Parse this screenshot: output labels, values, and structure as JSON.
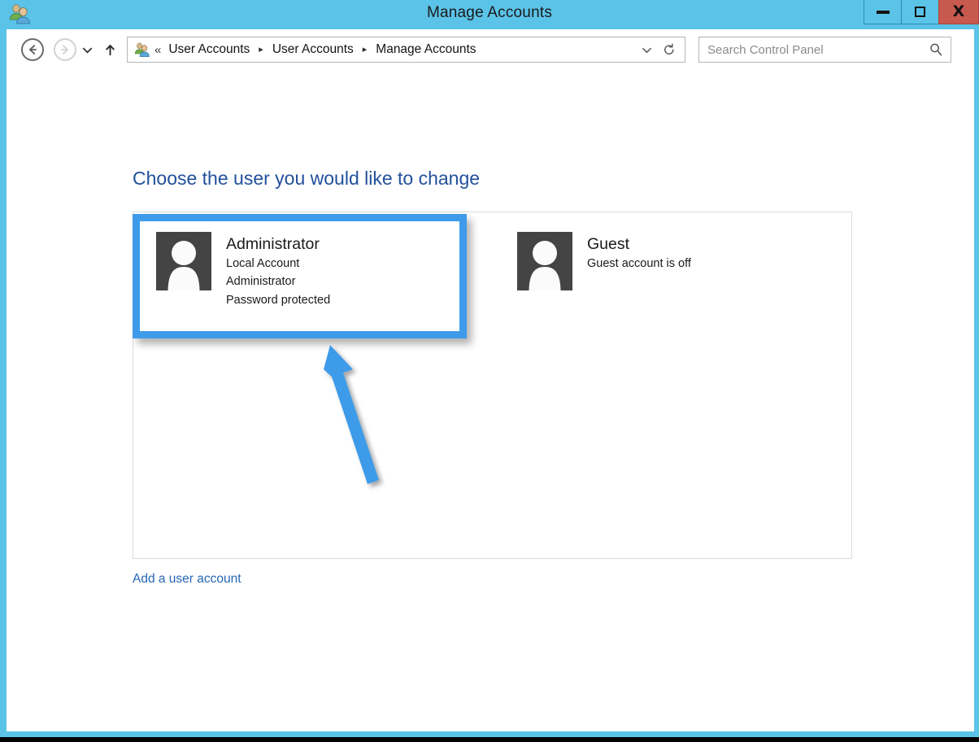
{
  "window": {
    "title": "Manage Accounts",
    "icon": "user-accounts-icon",
    "controls": {
      "minimize": "Minimize",
      "maximize": "Maximize",
      "close": "X"
    },
    "accent_color": "#5bc3e8",
    "close_color": "#c8594f"
  },
  "toolbar": {
    "back": "back-arrow",
    "forward": "forward-arrow",
    "recent_pages": "chevron-down",
    "up": "up-arrow",
    "refresh": "refresh-icon",
    "address_dropdown": "chevron-down"
  },
  "breadcrumb": {
    "icon": "user-accounts-icon",
    "overflow": "«",
    "separator": "▸",
    "items": [
      {
        "label": "User Accounts"
      },
      {
        "label": "User Accounts"
      },
      {
        "label": "Manage Accounts"
      }
    ]
  },
  "search": {
    "placeholder": "Search Control Panel",
    "value": "",
    "icon": "search-icon"
  },
  "main": {
    "heading": "Choose the user you would like to change",
    "heading_color": "#22509b",
    "accounts": [
      {
        "name": "Administrator",
        "lines": [
          "Local Account",
          "Administrator",
          "Password protected"
        ],
        "avatar": "user-avatar-icon"
      },
      {
        "name": "Guest",
        "lines": [
          "Guest account is off"
        ],
        "avatar": "user-avatar-icon"
      }
    ],
    "add_account_link": "Add a user account",
    "link_color": "#2666b5"
  },
  "annotation": {
    "highlight_color": "#3d9be9",
    "highlight_target": "Administrator",
    "arrow": "pointer-arrow"
  }
}
